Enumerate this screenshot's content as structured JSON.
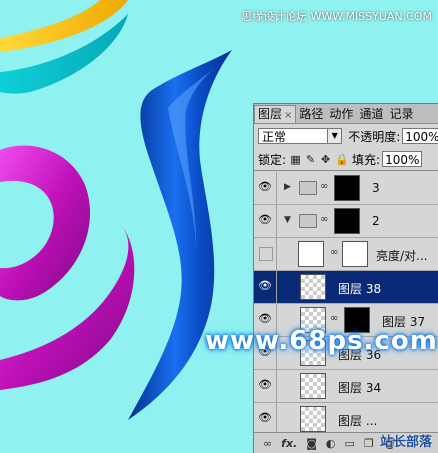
{
  "watermarks": {
    "top": "思缘设计论坛 WWW.MISSYUAN.COM",
    "middle": "www.68ps.com",
    "bottom_right": "站长部落"
  },
  "layers_panel": {
    "tabs": [
      {
        "label": "图层",
        "active": true
      },
      {
        "label": "路径",
        "active": false
      },
      {
        "label": "动作",
        "active": false
      },
      {
        "label": "通道",
        "active": false
      },
      {
        "label": "记录",
        "active": false
      }
    ],
    "close_glyph": "×",
    "blend_mode": "正常",
    "opacity_label": "不透明度:",
    "opacity_value": "100%",
    "lock_label": "锁定:",
    "fill_label": "填充:",
    "fill_value": "100%",
    "layers": [
      {
        "name": "3",
        "type": "group",
        "visible": true
      },
      {
        "name": "2",
        "type": "group",
        "visible": true
      },
      {
        "name": "亮度/对...",
        "type": "adjustment",
        "visible": false
      },
      {
        "name": "图层 38",
        "type": "layer",
        "visible": true,
        "selected": true
      },
      {
        "name": "图层 37",
        "type": "layer-mask",
        "visible": true
      },
      {
        "name": "图层 36",
        "type": "layer",
        "visible": true
      },
      {
        "name": "图层 34",
        "type": "layer",
        "visible": true
      },
      {
        "name": "图层 ...",
        "type": "layer",
        "visible": true
      }
    ],
    "bottom_icons": [
      "link-icon",
      "fx-icon",
      "mask-icon",
      "adjustment-icon",
      "folder-icon",
      "new-layer-icon",
      "trash-icon"
    ],
    "fx_label": "fx."
  },
  "colors": {
    "background": "#8ff2f0",
    "selected_layer": "#0a2a78",
    "blue_shape": "#0d52c9",
    "magenta_shape": "#d216c8"
  }
}
